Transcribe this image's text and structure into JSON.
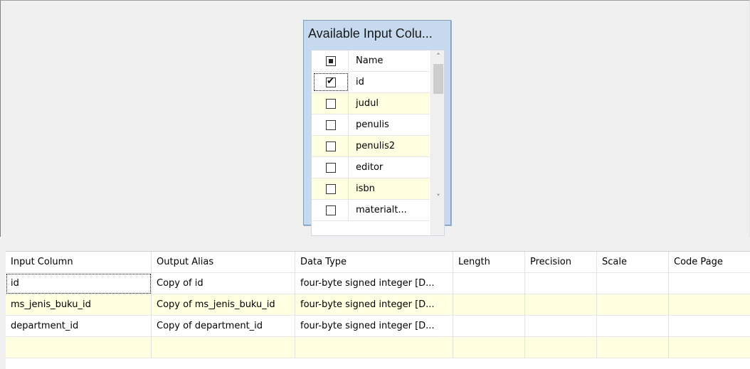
{
  "available_columns": {
    "title": "Available Input Colu...",
    "header": {
      "label": "Name"
    },
    "rows": [
      {
        "label": "id",
        "checked": true
      },
      {
        "label": "judul",
        "checked": false
      },
      {
        "label": "penulis",
        "checked": false
      },
      {
        "label": "penulis2",
        "checked": false
      },
      {
        "label": "editor",
        "checked": false
      },
      {
        "label": "isbn",
        "checked": false
      },
      {
        "label": "materialt...",
        "checked": false
      }
    ],
    "scroll_up_icon": "chevron-up-icon",
    "scroll_down_icon": "chevron-down-icon"
  },
  "mapping_grid": {
    "columns": [
      "Input Column",
      "Output Alias",
      "Data Type",
      "Length",
      "Precision",
      "Scale",
      "Code Page"
    ],
    "rows": [
      [
        "id",
        "Copy of id",
        "four-byte signed integer [D...",
        "",
        "",
        "",
        ""
      ],
      [
        "ms_jenis_buku_id",
        "Copy of ms_jenis_buku_id",
        "four-byte signed integer [D...",
        "",
        "",
        "",
        ""
      ],
      [
        "department_id",
        "Copy of department_id",
        "four-byte signed integer [D...",
        "",
        "",
        "",
        ""
      ],
      [
        "",
        "",
        "",
        "",
        "",
        "",
        ""
      ]
    ]
  },
  "colors": {
    "box_background": "#c7d9ee",
    "alt_row": "#ffffe1",
    "surface": "#f0f0f0"
  }
}
